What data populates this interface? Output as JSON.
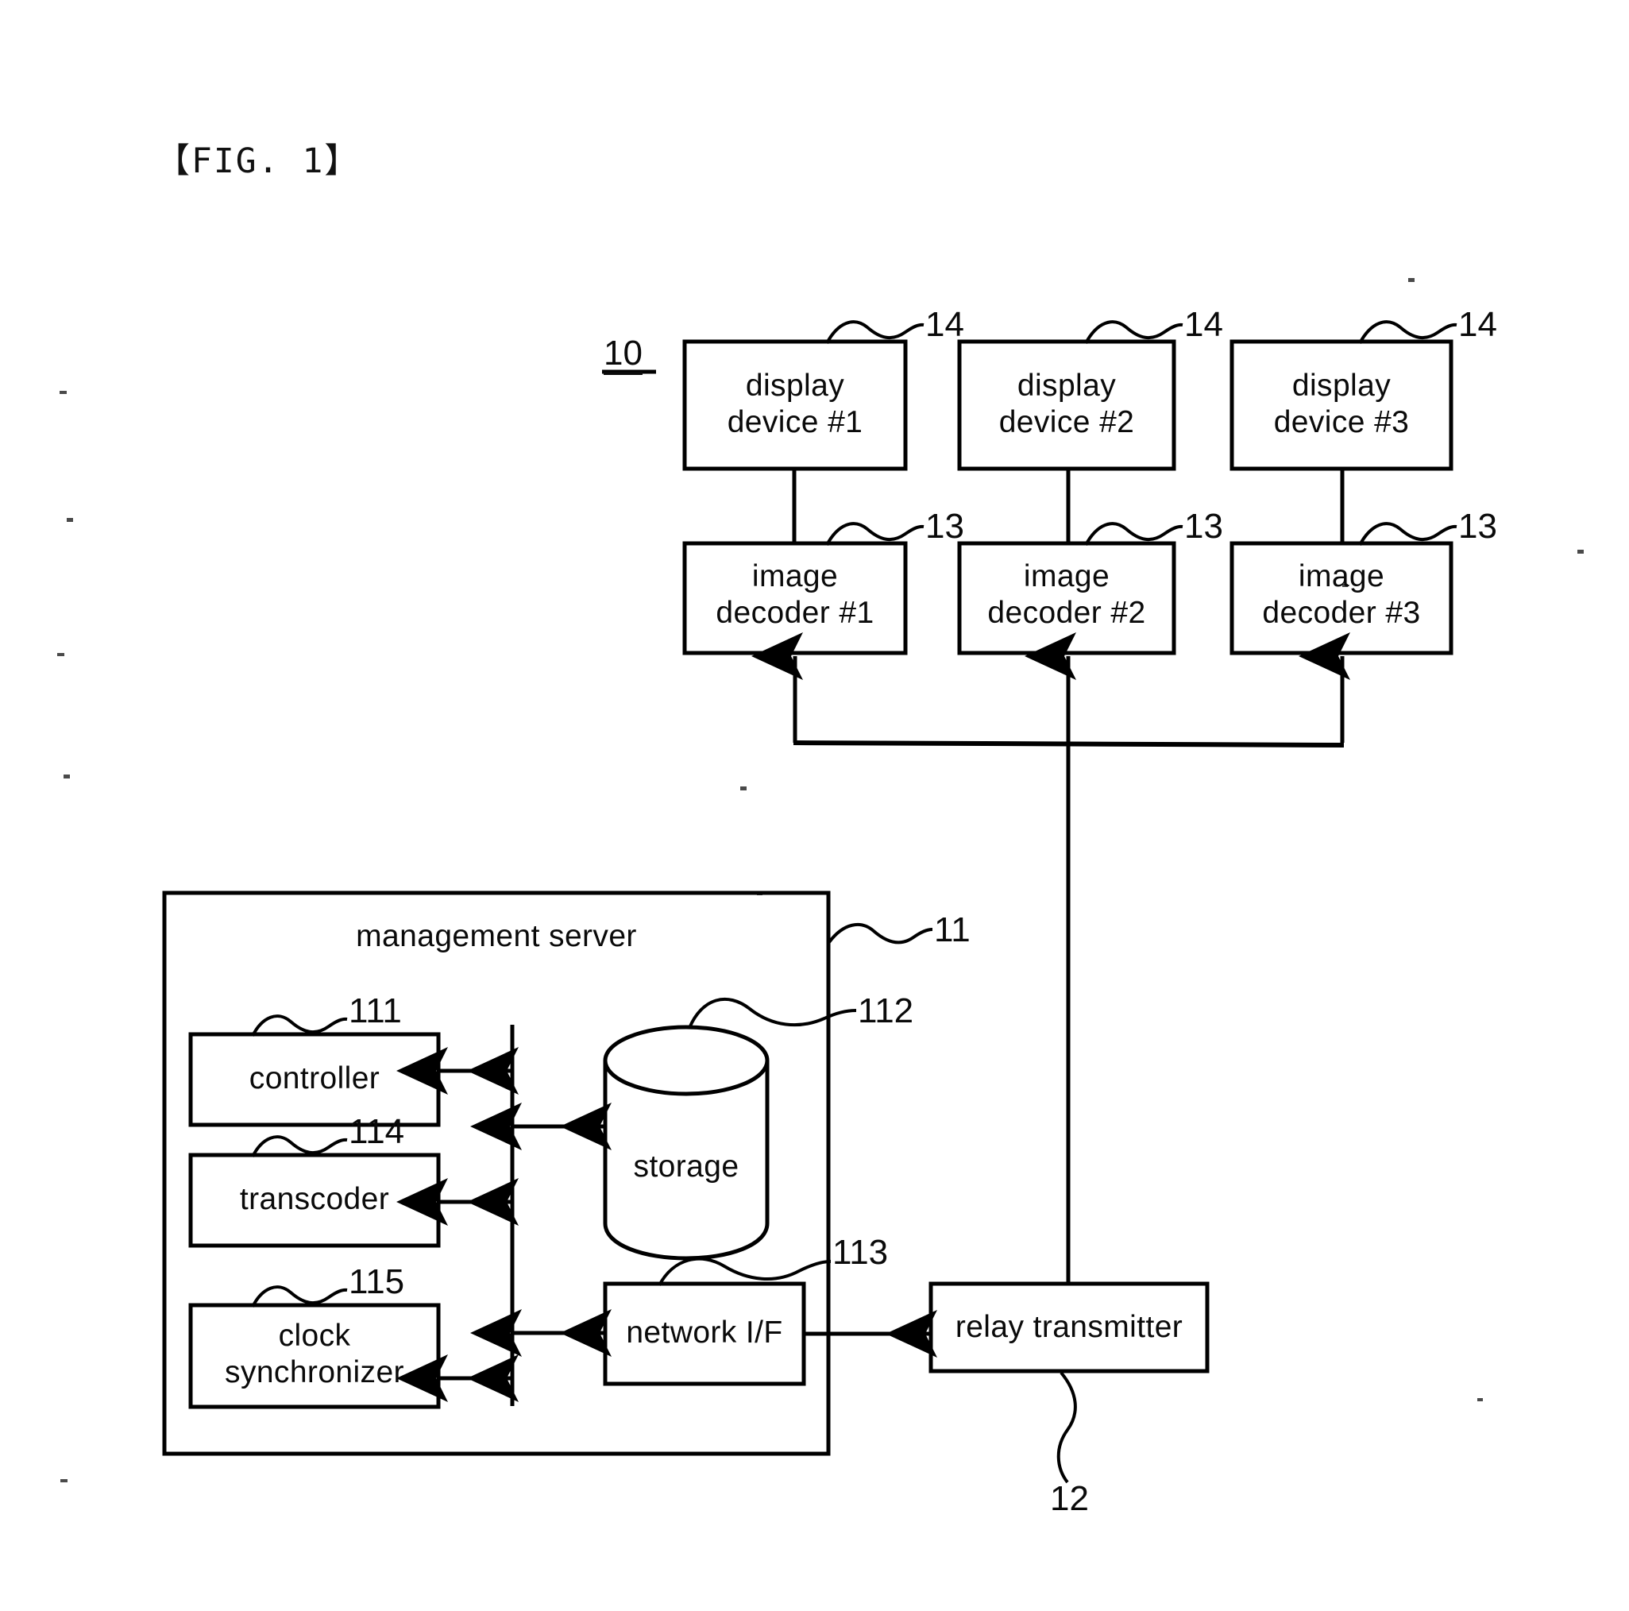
{
  "figure": {
    "title": "【FIG. 1】",
    "system_ref": "10"
  },
  "nodes": {
    "display_1": {
      "label": "display\ndevice #1",
      "ref": "14"
    },
    "display_2": {
      "label": "display\ndevice #2",
      "ref": "14"
    },
    "display_3": {
      "label": "display\ndevice #3",
      "ref": "14"
    },
    "decoder_1": {
      "label": "image\ndecoder #1",
      "ref": "13"
    },
    "decoder_2": {
      "label": "image\ndecoder #2",
      "ref": "13"
    },
    "decoder_3": {
      "label": "image\ndecoder #3",
      "ref": "13"
    },
    "management_server": {
      "label": "management server",
      "ref": "11"
    },
    "controller": {
      "label": "controller",
      "ref": "111"
    },
    "transcoder": {
      "label": "transcoder",
      "ref": "114"
    },
    "clock_synchronizer": {
      "label": "clock\nsynchronizer",
      "ref": "115"
    },
    "storage": {
      "label": "storage",
      "ref": "112"
    },
    "network_if": {
      "label": "network I/F",
      "ref": "113"
    },
    "relay_transmitter": {
      "label": "relay transmitter",
      "ref": "12"
    }
  },
  "colors": {
    "ink": "#000000",
    "paper": "#ffffff"
  }
}
